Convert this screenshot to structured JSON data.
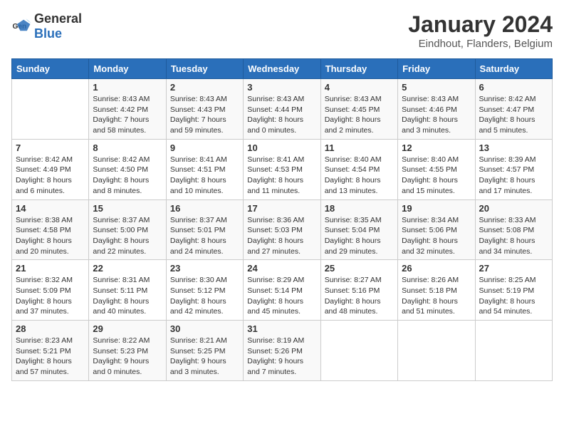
{
  "logo": {
    "general": "General",
    "blue": "Blue"
  },
  "title": "January 2024",
  "subtitle": "Eindhout, Flanders, Belgium",
  "days_of_week": [
    "Sunday",
    "Monday",
    "Tuesday",
    "Wednesday",
    "Thursday",
    "Friday",
    "Saturday"
  ],
  "weeks": [
    [
      {
        "num": "",
        "info": ""
      },
      {
        "num": "1",
        "info": "Sunrise: 8:43 AM\nSunset: 4:42 PM\nDaylight: 7 hours\nand 58 minutes."
      },
      {
        "num": "2",
        "info": "Sunrise: 8:43 AM\nSunset: 4:43 PM\nDaylight: 7 hours\nand 59 minutes."
      },
      {
        "num": "3",
        "info": "Sunrise: 8:43 AM\nSunset: 4:44 PM\nDaylight: 8 hours\nand 0 minutes."
      },
      {
        "num": "4",
        "info": "Sunrise: 8:43 AM\nSunset: 4:45 PM\nDaylight: 8 hours\nand 2 minutes."
      },
      {
        "num": "5",
        "info": "Sunrise: 8:43 AM\nSunset: 4:46 PM\nDaylight: 8 hours\nand 3 minutes."
      },
      {
        "num": "6",
        "info": "Sunrise: 8:42 AM\nSunset: 4:47 PM\nDaylight: 8 hours\nand 5 minutes."
      }
    ],
    [
      {
        "num": "7",
        "info": "Sunrise: 8:42 AM\nSunset: 4:49 PM\nDaylight: 8 hours\nand 6 minutes."
      },
      {
        "num": "8",
        "info": "Sunrise: 8:42 AM\nSunset: 4:50 PM\nDaylight: 8 hours\nand 8 minutes."
      },
      {
        "num": "9",
        "info": "Sunrise: 8:41 AM\nSunset: 4:51 PM\nDaylight: 8 hours\nand 10 minutes."
      },
      {
        "num": "10",
        "info": "Sunrise: 8:41 AM\nSunset: 4:53 PM\nDaylight: 8 hours\nand 11 minutes."
      },
      {
        "num": "11",
        "info": "Sunrise: 8:40 AM\nSunset: 4:54 PM\nDaylight: 8 hours\nand 13 minutes."
      },
      {
        "num": "12",
        "info": "Sunrise: 8:40 AM\nSunset: 4:55 PM\nDaylight: 8 hours\nand 15 minutes."
      },
      {
        "num": "13",
        "info": "Sunrise: 8:39 AM\nSunset: 4:57 PM\nDaylight: 8 hours\nand 17 minutes."
      }
    ],
    [
      {
        "num": "14",
        "info": "Sunrise: 8:38 AM\nSunset: 4:58 PM\nDaylight: 8 hours\nand 20 minutes."
      },
      {
        "num": "15",
        "info": "Sunrise: 8:37 AM\nSunset: 5:00 PM\nDaylight: 8 hours\nand 22 minutes."
      },
      {
        "num": "16",
        "info": "Sunrise: 8:37 AM\nSunset: 5:01 PM\nDaylight: 8 hours\nand 24 minutes."
      },
      {
        "num": "17",
        "info": "Sunrise: 8:36 AM\nSunset: 5:03 PM\nDaylight: 8 hours\nand 27 minutes."
      },
      {
        "num": "18",
        "info": "Sunrise: 8:35 AM\nSunset: 5:04 PM\nDaylight: 8 hours\nand 29 minutes."
      },
      {
        "num": "19",
        "info": "Sunrise: 8:34 AM\nSunset: 5:06 PM\nDaylight: 8 hours\nand 32 minutes."
      },
      {
        "num": "20",
        "info": "Sunrise: 8:33 AM\nSunset: 5:08 PM\nDaylight: 8 hours\nand 34 minutes."
      }
    ],
    [
      {
        "num": "21",
        "info": "Sunrise: 8:32 AM\nSunset: 5:09 PM\nDaylight: 8 hours\nand 37 minutes."
      },
      {
        "num": "22",
        "info": "Sunrise: 8:31 AM\nSunset: 5:11 PM\nDaylight: 8 hours\nand 40 minutes."
      },
      {
        "num": "23",
        "info": "Sunrise: 8:30 AM\nSunset: 5:12 PM\nDaylight: 8 hours\nand 42 minutes."
      },
      {
        "num": "24",
        "info": "Sunrise: 8:29 AM\nSunset: 5:14 PM\nDaylight: 8 hours\nand 45 minutes."
      },
      {
        "num": "25",
        "info": "Sunrise: 8:27 AM\nSunset: 5:16 PM\nDaylight: 8 hours\nand 48 minutes."
      },
      {
        "num": "26",
        "info": "Sunrise: 8:26 AM\nSunset: 5:18 PM\nDaylight: 8 hours\nand 51 minutes."
      },
      {
        "num": "27",
        "info": "Sunrise: 8:25 AM\nSunset: 5:19 PM\nDaylight: 8 hours\nand 54 minutes."
      }
    ],
    [
      {
        "num": "28",
        "info": "Sunrise: 8:23 AM\nSunset: 5:21 PM\nDaylight: 8 hours\nand 57 minutes."
      },
      {
        "num": "29",
        "info": "Sunrise: 8:22 AM\nSunset: 5:23 PM\nDaylight: 9 hours\nand 0 minutes."
      },
      {
        "num": "30",
        "info": "Sunrise: 8:21 AM\nSunset: 5:25 PM\nDaylight: 9 hours\nand 3 minutes."
      },
      {
        "num": "31",
        "info": "Sunrise: 8:19 AM\nSunset: 5:26 PM\nDaylight: 9 hours\nand 7 minutes."
      },
      {
        "num": "",
        "info": ""
      },
      {
        "num": "",
        "info": ""
      },
      {
        "num": "",
        "info": ""
      }
    ]
  ]
}
